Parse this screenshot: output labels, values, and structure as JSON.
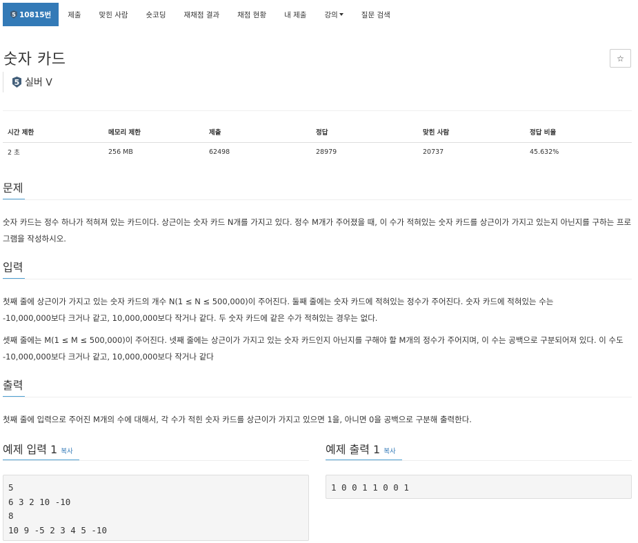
{
  "nav": {
    "problem_id": "10815번",
    "tier_number": "5",
    "items": [
      "제출",
      "맞힌 사람",
      "숏코딩",
      "재채점 결과",
      "채점 현황",
      "내 제출"
    ],
    "lecture": "강의",
    "question_search": "질문 검색"
  },
  "problem": {
    "title": "숫자 카드",
    "star_icon": "☆",
    "tier_badge": "5",
    "tier_label": "실버 V"
  },
  "info": {
    "headers": [
      "시간 제한",
      "메모리 제한",
      "제출",
      "정답",
      "맞힌 사람",
      "정답 비율"
    ],
    "values": [
      "2 초",
      "256 MB",
      "62498",
      "28979",
      "20737",
      "45.632%"
    ]
  },
  "sections": {
    "description_title": "문제",
    "description": "숫자 카드는 정수 하나가 적혀져 있는 카드이다. 상근이는 숫자 카드 N개를 가지고 있다. 정수 M개가 주어졌을 때, 이 수가 적혀있는 숫자 카드를 상근이가 가지고 있는지 아닌지를 구하는 프로그램을 작성하시오.",
    "input_title": "입력",
    "input_p1": "첫째 줄에 상근이가 가지고 있는 숫자 카드의 개수 N(1 ≤ N ≤ 500,000)이 주어진다. 둘째 줄에는 숫자 카드에 적혀있는 정수가 주어진다. 숫자 카드에 적혀있는 수는 -10,000,000보다 크거나 같고, 10,000,000보다 작거나 같다. 두 숫자 카드에 같은 수가 적혀있는 경우는 없다.",
    "input_p2": "셋째 줄에는 M(1 ≤ M ≤ 500,000)이 주어진다. 넷째 줄에는 상근이가 가지고 있는 숫자 카드인지 아닌지를 구해야 할 M개의 정수가 주어지며, 이 수는 공백으로 구분되어져 있다. 이 수도 -10,000,000보다 크거나 같고, 10,000,000보다 작거나 같다",
    "output_title": "출력",
    "output_p": "첫째 줄에 입력으로 주어진 M개의 수에 대해서, 각 수가 적힌 숫자 카드를 상근이가 가지고 있으면 1을, 아니면 0을 공백으로 구분해 출력한다."
  },
  "samples": {
    "input_title": "예제 입력 1",
    "output_title": "예제 출력 1",
    "copy_label": "복사",
    "input_text": "5\n6 3 2 10 -10\n8\n10 9 -5 2 3 4 5 -10",
    "output_text": "1 0 0 1 1 0 0 1"
  },
  "colors": {
    "accent": "#337ab7",
    "tier": "#435f7a"
  }
}
